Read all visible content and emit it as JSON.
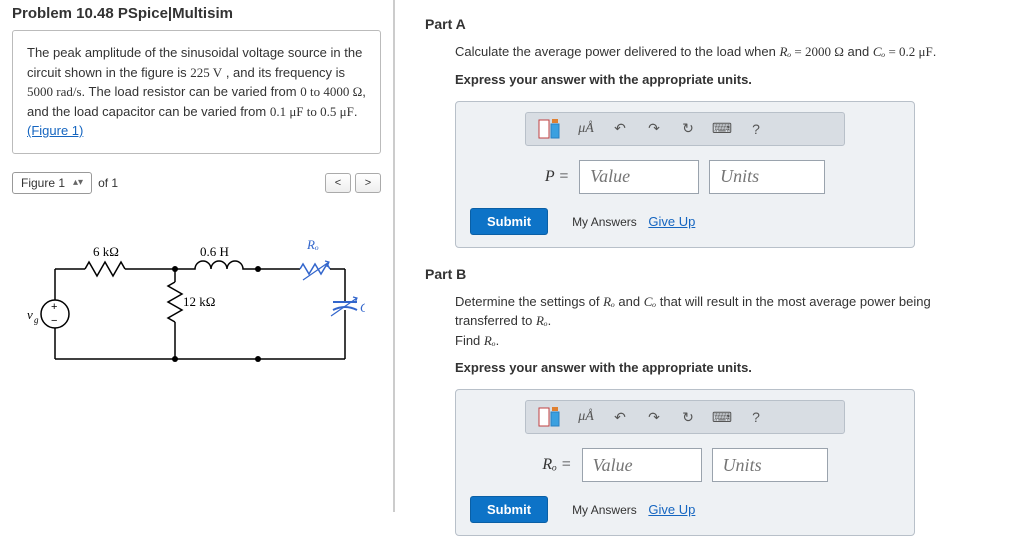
{
  "problem": {
    "title": "Problem 10.48 PSpice|Multisim",
    "desc_parts": {
      "t1": "The peak amplitude of the sinusoidal voltage source in the circuit shown in the figure is ",
      "v1": "225 V",
      "t2": " , and its frequency is ",
      "v2": "5000 rad/s",
      "t3": ". The load resistor can be varied from ",
      "v3": "0 to 4000 Ω",
      "t4": ", and the load capacitor can be varied from ",
      "v4": "0.1 μF to 0.5 μF",
      "t5": ". ",
      "figlink": "(Figure 1)"
    },
    "figure_label": "Figure 1",
    "figure_of": "of 1"
  },
  "circuit": {
    "r1": "6 kΩ",
    "l1": "0.6 H",
    "r2": "12 kΩ",
    "ro": "Rₒ",
    "co": "Cₒ",
    "vg": "vg"
  },
  "partA": {
    "header": "Part A",
    "prompt_parts": {
      "t1": "Calculate the average power delivered to the load when ",
      "ro": "Rₒ",
      "eq1": " = 2000 Ω",
      "and": " and ",
      "co": "Cₒ",
      "eq2": " = 0.2 μF",
      "end": "."
    },
    "instr": "Express your answer with the appropriate units.",
    "var": "P =",
    "value_ph": "Value",
    "units_ph": "Units",
    "submit": "Submit",
    "my_answers": "My Answers",
    "give_up": "Give Up",
    "mu_label": "μÅ"
  },
  "partB": {
    "header": "Part B",
    "prompt_parts": {
      "t1": "Determine the settings of ",
      "ro": "Rₒ",
      "and1": " and ",
      "co": "Cₒ",
      "t2": " that will result in the most average power being transferred to ",
      "ro2": "Rₒ",
      "end1": ".",
      "find": "Find ",
      "ro3": "Rₒ",
      "end2": "."
    },
    "instr": "Express your answer with the appropriate units.",
    "var": "Rₒ =",
    "value_ph": "Value",
    "units_ph": "Units",
    "submit": "Submit",
    "my_answers": "My Answers",
    "give_up": "Give Up",
    "mu_label": "μÅ"
  }
}
